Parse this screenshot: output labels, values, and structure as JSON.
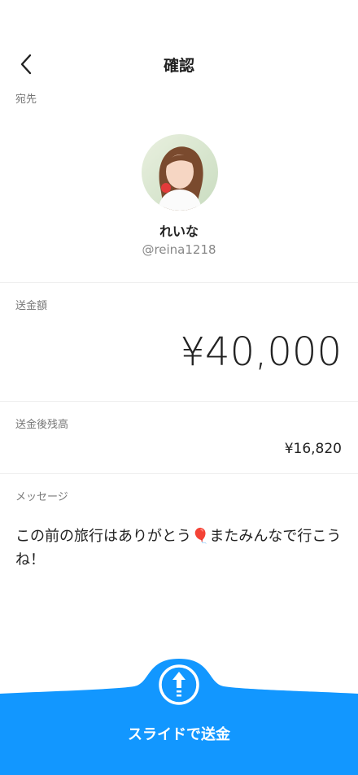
{
  "header": {
    "title": "確認"
  },
  "recipient": {
    "label": "宛先",
    "name": "れいな",
    "handle": "@reina1218"
  },
  "amount": {
    "label": "送金額",
    "value": "¥40,000"
  },
  "balance": {
    "label": "送金後残高",
    "value": "¥16,820"
  },
  "message": {
    "label": "メッセージ",
    "text": "この前の旅行はありがとう🎈またみんなで行こうね！"
  },
  "slide": {
    "label": "スライドで送金",
    "color": "#1297FF"
  }
}
